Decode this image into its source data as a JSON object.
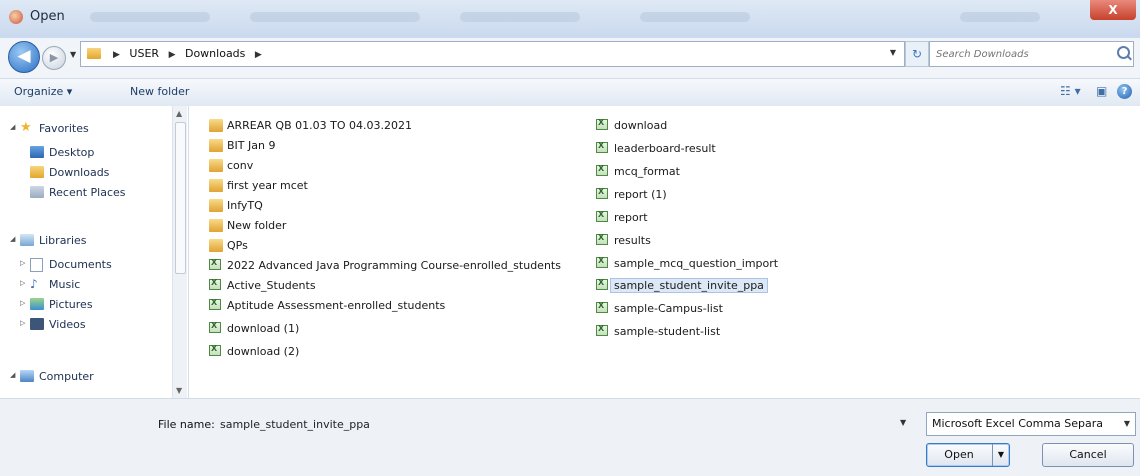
{
  "window": {
    "title": "Open",
    "close_glyph": "X"
  },
  "address": {
    "crumbs": [
      "USER",
      "Downloads"
    ],
    "search_placeholder": "Search Downloads"
  },
  "toolbar": {
    "organize": "Organize ▾",
    "new_folder": "New folder"
  },
  "nav": {
    "favorites": "Favorites",
    "desktop": "Desktop",
    "downloads": "Downloads",
    "recent_places": "Recent Places",
    "libraries": "Libraries",
    "documents": "Documents",
    "music": "Music",
    "pictures": "Pictures",
    "videos": "Videos",
    "computer": "Computer"
  },
  "files": {
    "col1": [
      "ARREAR QB 01.03 TO 04.03.2021",
      "BIT Jan 9",
      "conv",
      "first year mcet",
      "InfyTQ",
      "New folder",
      "QPs",
      "2022 Advanced Java Programming Course-enrolled_students",
      "Active_Students",
      "Aptitude Assessment-enrolled_students",
      "download (1)",
      "download (2)"
    ],
    "col2": [
      "download",
      "leaderboard-result",
      "mcq_format",
      "report (1)",
      "report",
      "results",
      "sample_mcq_question_import",
      "sample_student_invite_ppa",
      "sample-Campus-list",
      "sample-student-list"
    ]
  },
  "bottom": {
    "file_name_label": "File name:",
    "file_name_value": "sample_student_invite_ppa",
    "file_type": "Microsoft Excel Comma Separa",
    "open": "Open",
    "cancel": "Cancel"
  },
  "colors": {
    "accent": "#3b79c7",
    "toolbar_text": "#1f3e66"
  }
}
